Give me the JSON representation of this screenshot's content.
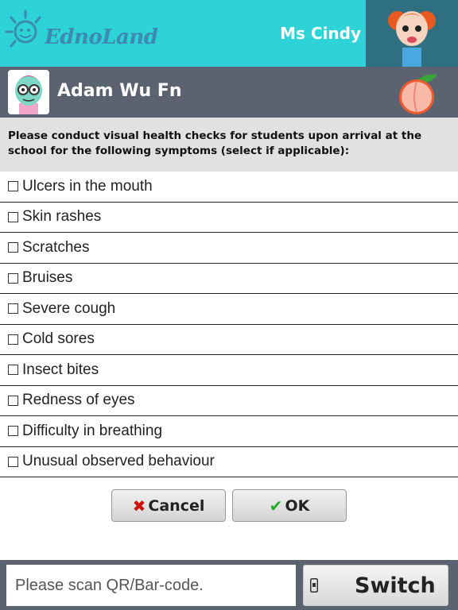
{
  "header": {
    "logo_text": "EdnoLand",
    "teacher_name": "Ms Cindy"
  },
  "student": {
    "name": "Adam Wu Fn"
  },
  "instructions": "Please conduct visual health checks for students upon arrival at the school for the following symptoms (select if applicable):",
  "symptoms": [
    {
      "label": "Ulcers in the mouth",
      "checked": false
    },
    {
      "label": "Skin rashes",
      "checked": false
    },
    {
      "label": "Scratches",
      "checked": false
    },
    {
      "label": "Bruises",
      "checked": false
    },
    {
      "label": "Severe cough",
      "checked": false
    },
    {
      "label": "Cold sores",
      "checked": false
    },
    {
      "label": "Insect bites",
      "checked": false
    },
    {
      "label": "Redness of eyes",
      "checked": false
    },
    {
      "label": "Difficulty in breathing",
      "checked": false
    },
    {
      "label": "Unusual observed behaviour",
      "checked": false
    }
  ],
  "actions": {
    "cancel_label": "Cancel",
    "ok_label": "OK"
  },
  "footer": {
    "scan_placeholder": "Please scan QR/Bar-code.",
    "switch_label": "Switch"
  },
  "colors": {
    "header_bg": "#2ed3d8",
    "bar_bg": "#5c6370",
    "cancel_icon": "#cc1111",
    "ok_icon": "#22aa22"
  }
}
